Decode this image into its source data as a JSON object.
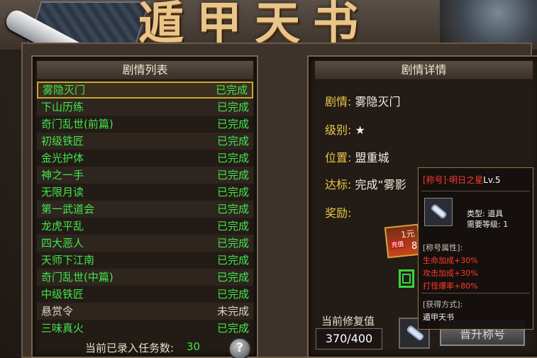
{
  "header": {
    "title": "遁甲天书"
  },
  "list_panel": {
    "title": "剧情列表",
    "quests": [
      {
        "name": "雾隐灭门",
        "status": "已完成",
        "selected": true
      },
      {
        "name": "下山历练",
        "status": "已完成"
      },
      {
        "name": "奇门乱世(前篇)",
        "status": "已完成"
      },
      {
        "name": "初级铁匠",
        "status": "已完成"
      },
      {
        "name": "金光护体",
        "status": "已完成"
      },
      {
        "name": "神之一手",
        "status": "已完成"
      },
      {
        "name": "无限月读",
        "status": "已完成"
      },
      {
        "name": "第一武道会",
        "status": "已完成"
      },
      {
        "name": "龙虎平乱",
        "status": "已完成"
      },
      {
        "name": "四大恶人",
        "status": "已完成"
      },
      {
        "name": "天师下江南",
        "status": "已完成"
      },
      {
        "name": "奇门乱世(中篇)",
        "status": "已完成"
      },
      {
        "name": "中级铁匠",
        "status": "已完成"
      },
      {
        "name": "悬赏令",
        "status": "未完成"
      },
      {
        "name": "三味真火",
        "status": "已完成"
      }
    ],
    "count_label": "当前已录入任务数:",
    "count_value": "30",
    "help_label": "?"
  },
  "detail_panel": {
    "title": "剧情详情",
    "plot_label": "剧情:",
    "plot_value": "雾隐灭门",
    "level_label": "级别:",
    "level_value": "★",
    "location_label": "位置:",
    "location_value": "盟重城",
    "goal_label": "达标:",
    "goal_value": "完成“雾影",
    "reward_label": "奖励:",
    "reward_coupon": "1元",
    "reward_coupon_sub": "充值",
    "reward_count": "8",
    "repair_label": "当前修复值",
    "repair_value": "370/400",
    "upgrade_button": "晋升称号"
  },
  "tooltip": {
    "title_prefix": "[称号]·明日之星",
    "title_level": "Lv.5",
    "type_line": "类型: 道具",
    "level_line": "需要等级: 1",
    "attr_header": "[称号属性]:",
    "attrs": [
      "生命加成+30%",
      "攻击加成+30%",
      "打怪爆率+80%"
    ],
    "source_header": "[获得方式]:",
    "source_value": "遁甲天书"
  },
  "colors": {
    "completed": "#42e64c",
    "pending": "#d8d2c8",
    "label_gold": "#e9c84a",
    "tooltip_red": "#ff3b30"
  }
}
